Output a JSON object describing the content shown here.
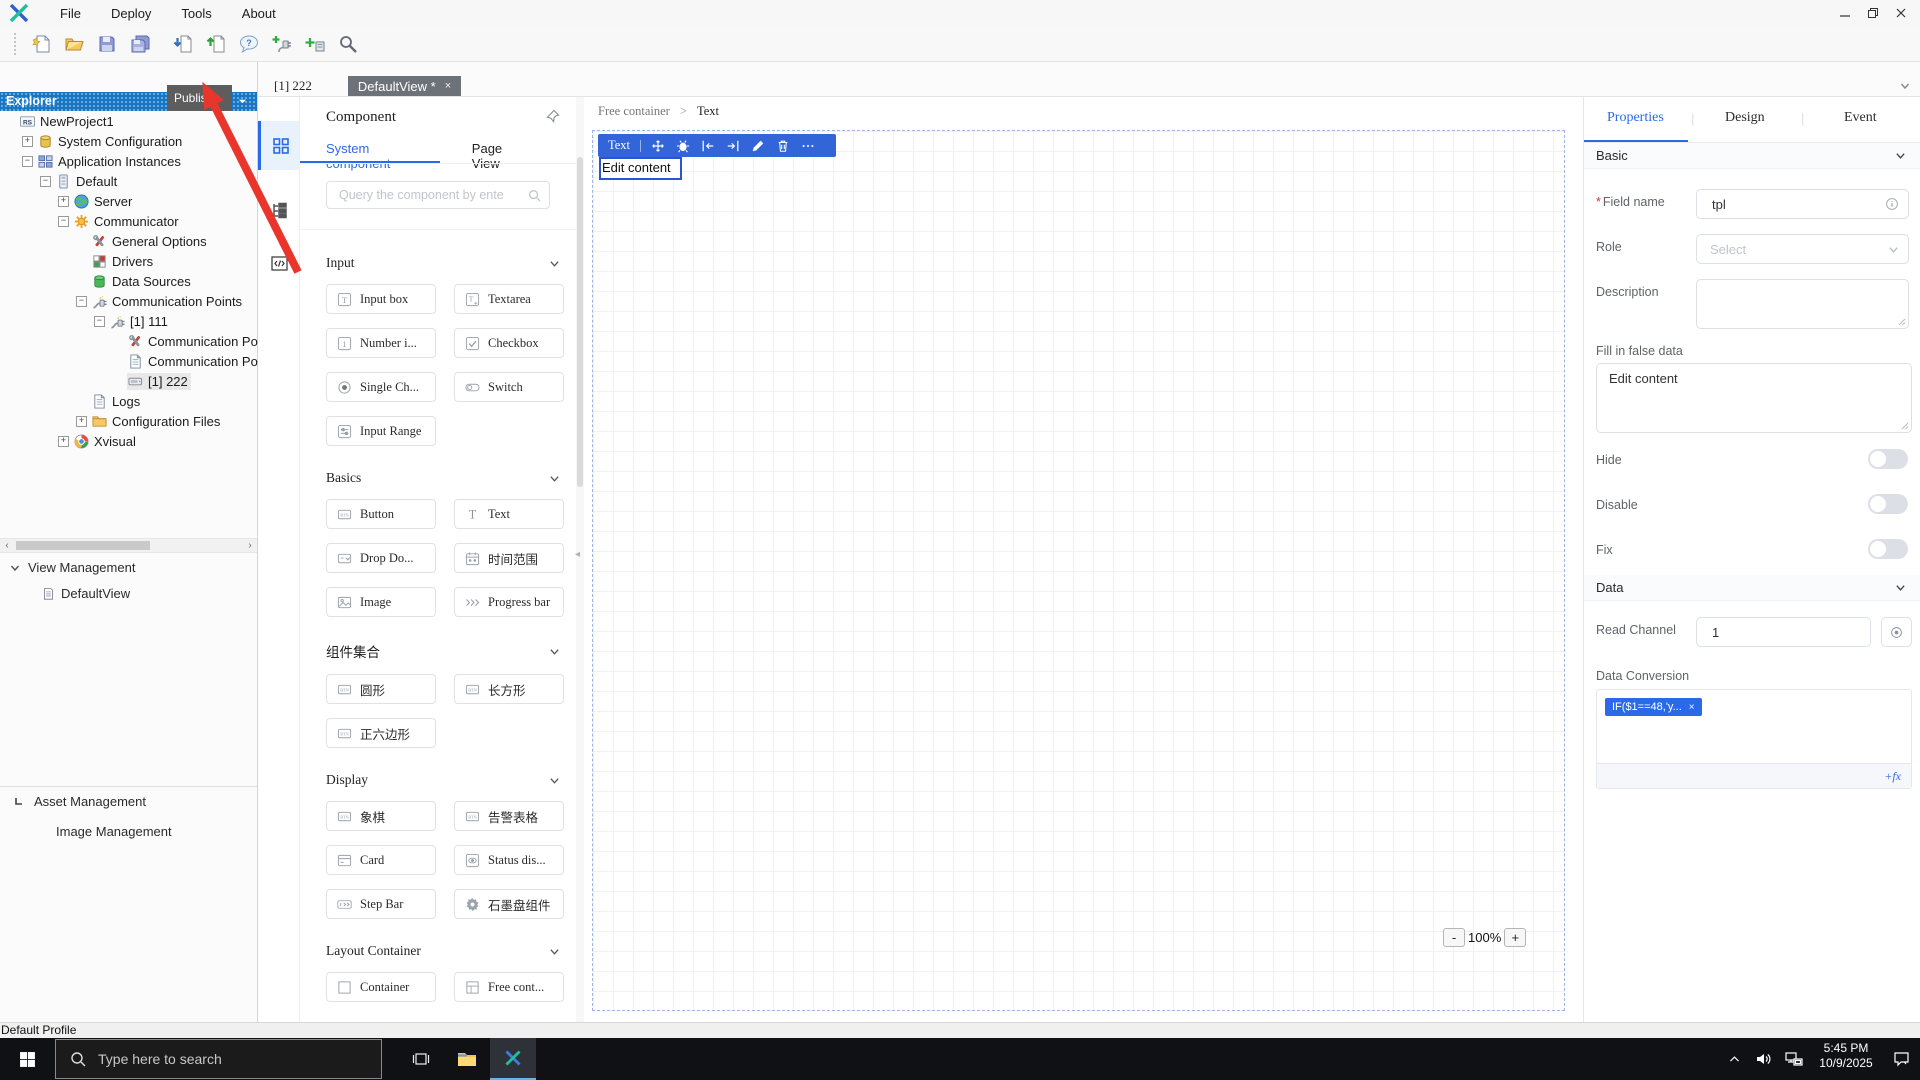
{
  "colors": {
    "accent": "#2a6ae9",
    "explorer_header": "#1877c5",
    "selection_toolbar": "#3265d8",
    "tag": "#2a6ae9",
    "arrow": "#e8362c"
  },
  "menubar": {
    "items": [
      "File",
      "Deploy",
      "Tools",
      "About"
    ]
  },
  "toolbar": {
    "buttons": [
      {
        "name": "new",
        "icon": "doc-new"
      },
      {
        "name": "open",
        "icon": "folder-open"
      },
      {
        "name": "save",
        "icon": "save"
      },
      {
        "name": "save-all",
        "icon": "save-all"
      },
      {
        "name": "import",
        "icon": "import"
      },
      {
        "name": "publish",
        "icon": "publish"
      },
      {
        "name": "help",
        "icon": "help"
      },
      {
        "name": "add-device",
        "icon": "add-device"
      },
      {
        "name": "add-component",
        "icon": "add-tag"
      },
      {
        "name": "search",
        "icon": "search-tool"
      }
    ]
  },
  "annotation": {
    "tooltip": "Publish"
  },
  "explorer": {
    "title": "Explorer",
    "tree": [
      {
        "label": "NewProject1",
        "icon": "rs",
        "level": 0
      },
      {
        "label": "System Configuration",
        "icon": "db-yellow",
        "level": 1,
        "expander": "plus"
      },
      {
        "label": "Application Instances",
        "icon": "app-grid",
        "level": 1,
        "expander": "minus"
      },
      {
        "label": "Default",
        "icon": "server-box",
        "level": 2,
        "expander": "minus"
      },
      {
        "label": "Server",
        "icon": "globe",
        "level": 3,
        "expander": "plus"
      },
      {
        "label": "Communicator",
        "icon": "sun",
        "level": 3,
        "expander": "minus"
      },
      {
        "label": "General Options",
        "icon": "tools",
        "level": 4
      },
      {
        "label": "Drivers",
        "icon": "drivers",
        "level": 4
      },
      {
        "label": "Data Sources",
        "icon": "db-green",
        "level": 4
      },
      {
        "label": "Communication Points",
        "icon": "plug",
        "level": 4,
        "expander": "minus"
      },
      {
        "label": "[1] 111",
        "icon": "plug",
        "level": 5,
        "expander": "minus"
      },
      {
        "label": "Communication Poin",
        "icon": "tools",
        "level": 6
      },
      {
        "label": "Communication Poin",
        "icon": "doc",
        "level": 6
      },
      {
        "label": "[1] 222",
        "icon": "device",
        "level": 6,
        "selected": true
      },
      {
        "label": "Logs",
        "icon": "doc",
        "level": 4
      },
      {
        "label": "Configuration Files",
        "icon": "folder",
        "level": 4,
        "expander": "plus"
      },
      {
        "label": "Xvisual",
        "icon": "chrome",
        "level": 3,
        "expander": "plus"
      }
    ]
  },
  "view_management": {
    "title": "View Management",
    "items": [
      {
        "label": "DefaultView",
        "icon": "doc"
      }
    ]
  },
  "asset_management": {
    "title": "Asset Management",
    "items": [
      {
        "label": "Image Management"
      }
    ]
  },
  "editor_tabs": [
    {
      "label": "[1] 222",
      "active": false,
      "closable": false
    },
    {
      "label": "DefaultView *",
      "active": true,
      "closable": true
    }
  ],
  "component_panel": {
    "title": "Component",
    "tabs": [
      {
        "label": "System component",
        "active": true
      },
      {
        "label": "Page View",
        "active": false
      }
    ],
    "search_placeholder": "Query the component by ente",
    "sections": [
      {
        "title": "Input",
        "items": [
          {
            "label": "Input box",
            "icon": "ci-input"
          },
          {
            "label": "Textarea",
            "icon": "ci-textarea"
          },
          {
            "label": "Number i...",
            "icon": "ci-number"
          },
          {
            "label": "Checkbox",
            "icon": "ci-check"
          },
          {
            "label": "Single Ch...",
            "icon": "ci-radio"
          },
          {
            "label": "Switch",
            "icon": "ci-switch"
          },
          {
            "label": "Input Range",
            "icon": "ci-range"
          }
        ]
      },
      {
        "title": "Basics",
        "items": [
          {
            "label": "Button",
            "icon": "ci-btn"
          },
          {
            "label": "Text",
            "icon": "ci-text"
          },
          {
            "label": "Drop Do...",
            "icon": "ci-drop"
          },
          {
            "label": "时间范围",
            "icon": "ci-cal"
          },
          {
            "label": "Image",
            "icon": "ci-img"
          },
          {
            "label": "Progress bar",
            "icon": "ci-prog"
          }
        ]
      },
      {
        "title": "组件集合",
        "items": [
          {
            "label": "圆形",
            "icon": "ci-btn"
          },
          {
            "label": "长方形",
            "icon": "ci-btn"
          },
          {
            "label": "正六边形",
            "icon": "ci-btn"
          }
        ]
      },
      {
        "title": "Display",
        "items": [
          {
            "label": "象棋",
            "icon": "ci-btn"
          },
          {
            "label": "告警表格",
            "icon": "ci-btn"
          },
          {
            "label": "Card",
            "icon": "ci-card"
          },
          {
            "label": "Status dis...",
            "icon": "ci-eye"
          },
          {
            "label": "Step Bar",
            "icon": "ci-step"
          },
          {
            "label": "石墨盘组件",
            "icon": "ci-gear"
          }
        ]
      },
      {
        "title": "Layout Container",
        "items": [
          {
            "label": "Container",
            "icon": "ci-cont"
          },
          {
            "label": "Free cont...",
            "icon": "ci-free"
          }
        ]
      }
    ]
  },
  "canvas": {
    "breadcrumb": [
      {
        "label": "Free container"
      },
      {
        "label": "Text"
      }
    ],
    "breadcrumb_separator": ">",
    "selection_toolbar": {
      "label": "Text",
      "icons": [
        "move",
        "bug",
        "align-in",
        "align-out",
        "edit",
        "delete",
        "more"
      ]
    },
    "text_content": "Edit content",
    "zoom": {
      "minus": "-",
      "level": "100%",
      "plus": "+"
    }
  },
  "properties_panel": {
    "tabs": [
      {
        "label": "Properties",
        "active": true
      },
      {
        "label": "Design",
        "active": false
      },
      {
        "label": "Event",
        "active": false
      }
    ],
    "basic": {
      "title": "Basic",
      "field_name": {
        "label": "Field name",
        "required": "*",
        "value": "tpl"
      },
      "role": {
        "label": "Role",
        "placeholder": "Select"
      },
      "description": {
        "label": "Description",
        "value": ""
      },
      "fill_false_label": "Fill in false data",
      "fill_false_value": "Edit content",
      "toggles": [
        {
          "label": "Hide",
          "on": false
        },
        {
          "label": "Disable",
          "on": false
        },
        {
          "label": "Fix",
          "on": false
        }
      ]
    },
    "data": {
      "title": "Data",
      "read_channel": {
        "label": "Read Channel",
        "value": "1"
      },
      "conversion": {
        "label": "Data Conversion",
        "tag": "IF($1==48,'y...",
        "remove": "×",
        "fx": "+fx"
      }
    }
  },
  "statusbar": {
    "text": "Default Profile"
  },
  "taskbar": {
    "search_placeholder": "Type here to search",
    "clock": {
      "time": "5:45 PM",
      "date": "10/9/2025"
    }
  }
}
